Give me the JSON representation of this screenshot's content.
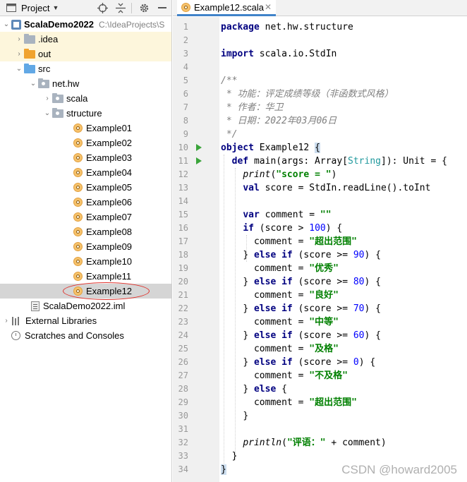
{
  "project_panel": {
    "title": "Project",
    "icons": [
      "project-window-icon",
      "chevron-down-icon",
      "locate-icon",
      "collapse-all-icon",
      "settings-gear-icon",
      "hide-panel-icon"
    ]
  },
  "tree": {
    "root_name": "ScalaDemo2022",
    "root_path": "C:\\IdeaProjects\\S",
    "idea": ".idea",
    "out": "out",
    "src": "src",
    "pkg": "net.hw",
    "scala": "scala",
    "structure": "structure",
    "files": [
      "Example01",
      "Example02",
      "Example03",
      "Example04",
      "Example05",
      "Example06",
      "Example07",
      "Example08",
      "Example09",
      "Example10",
      "Example11",
      "Example12"
    ],
    "iml": "ScalaDemo2022.iml",
    "libraries": "External Libraries",
    "scratches": "Scratches and Consoles",
    "selected": "Example12"
  },
  "editor": {
    "tab_title": "Example12.scala",
    "line_numbers": [
      "1",
      "2",
      "3",
      "4",
      "5",
      "6",
      "7",
      "8",
      "9",
      "10",
      "11",
      "12",
      "13",
      "14",
      "15",
      "16",
      "17",
      "18",
      "19",
      "20",
      "21",
      "22",
      "23",
      "24",
      "25",
      "26",
      "27",
      "28",
      "29",
      "30",
      "31",
      "32",
      "33",
      "34"
    ],
    "current_line": "34"
  },
  "code": {
    "l1_kw": "package",
    "l1_rest": " net.hw.structure",
    "l3_kw": "import",
    "l3_rest": " scala.io.StdIn",
    "l5": "/**",
    "l6": " * 功能：评定成绩等级（非函数式风格）",
    "l7": " * 作者：华卫",
    "l8": " * 日期：2022年03月06日",
    "l9": " */",
    "l10_kw": "object",
    "l10_name": " Example12 ",
    "l10_brace": "{",
    "l11_kw": "def",
    "l11_a": " main(args: Array[",
    "l11_type": "String",
    "l11_b": "]): Unit = {",
    "l12_fn": "print",
    "l12_a": "(",
    "l12_str": "\"score = \"",
    "l12_b": ")",
    "l13_kw": "val",
    "l13_rest": " score = StdIn.readLine().toInt",
    "l15_kw": "var",
    "l15_a": " comment = ",
    "l15_str": "\"\"",
    "l16_kw": "if",
    "l16_a": " (score > ",
    "l16_num": "100",
    "l16_b": ") {",
    "l17_a": "comment = ",
    "l17_str": "\"超出范围\"",
    "l18_a": "} ",
    "l18_kw1": "else",
    "l18_sp": " ",
    "l18_kw2": "if",
    "l18_b": " (score >= ",
    "l18_num": "90",
    "l18_c": ") {",
    "l19_a": "comment = ",
    "l19_str": "\"优秀\"",
    "l20_a": "} ",
    "l20_kw1": "else",
    "l20_sp": " ",
    "l20_kw2": "if",
    "l20_b": " (score >= ",
    "l20_num": "80",
    "l20_c": ") {",
    "l21_a": "comment = ",
    "l21_str": "\"良好\"",
    "l22_a": "} ",
    "l22_kw1": "else",
    "l22_sp": " ",
    "l22_kw2": "if",
    "l22_b": " (score >= ",
    "l22_num": "70",
    "l22_c": ") {",
    "l23_a": "comment = ",
    "l23_str": "\"中等\"",
    "l24_a": "} ",
    "l24_kw1": "else",
    "l24_sp": " ",
    "l24_kw2": "if",
    "l24_b": " (score >= ",
    "l24_num": "60",
    "l24_c": ") {",
    "l25_a": "comment = ",
    "l25_str": "\"及格\"",
    "l26_a": "} ",
    "l26_kw1": "else",
    "l26_sp": " ",
    "l26_kw2": "if",
    "l26_b": " (score >= ",
    "l26_num": "0",
    "l26_c": ") {",
    "l27_a": "comment = ",
    "l27_str": "\"不及格\"",
    "l28_a": "} ",
    "l28_kw": "else",
    "l28_b": " {",
    "l29_a": "comment = ",
    "l29_str": "\"超出范围\"",
    "l30": "}",
    "l32_fn": "println",
    "l32_a": "(",
    "l32_str": "\"评语：\"",
    "l32_b": " + comment)",
    "l33": "}",
    "l34": "}"
  },
  "watermark": "CSDN @howard2005",
  "colors": {
    "keyword": "#000080",
    "string": "#008000",
    "number": "#0000ff",
    "comment": "#808080",
    "type": "#20999d",
    "selection": "#d5d5d5",
    "highlight_row": "#fdf6dc",
    "run_icon": "#3aa43a",
    "annotation_ellipse": "#e0302a"
  }
}
